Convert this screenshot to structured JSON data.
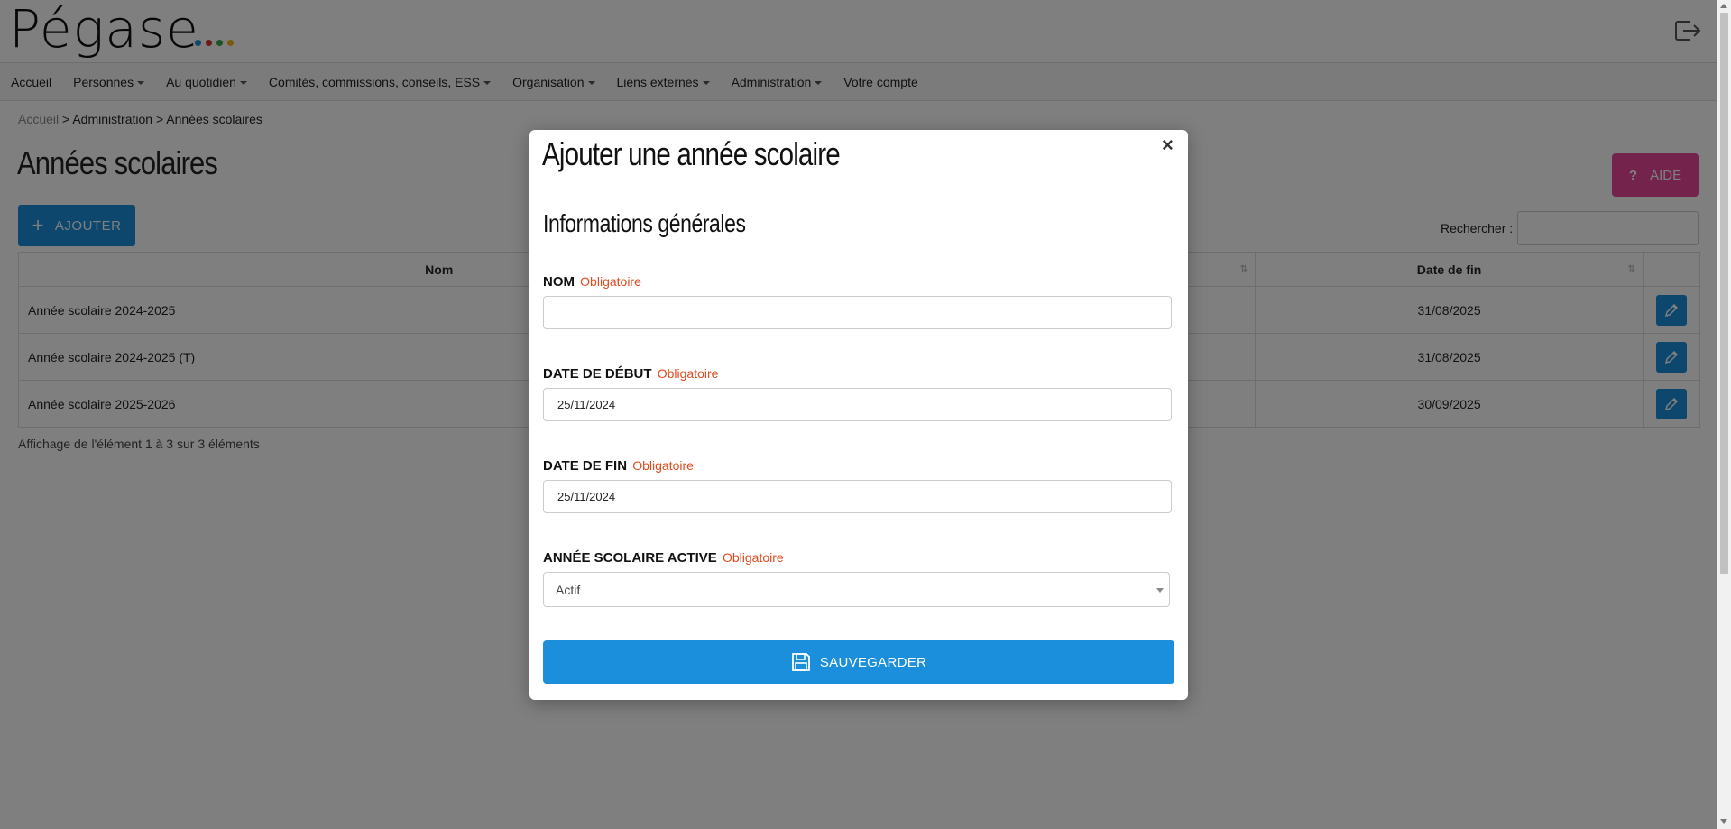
{
  "header": {
    "logo_text": "Pégase",
    "logo_dot_colors": [
      "#1b8fdc",
      "#d9352b",
      "#3aa64c",
      "#f2b21a"
    ]
  },
  "nav": {
    "items": [
      {
        "label": "Accueil",
        "dropdown": false
      },
      {
        "label": "Personnes",
        "dropdown": true
      },
      {
        "label": "Au quotidien",
        "dropdown": true
      },
      {
        "label": "Comités, commissions, conseils, ESS",
        "dropdown": true
      },
      {
        "label": "Organisation",
        "dropdown": true
      },
      {
        "label": "Liens externes",
        "dropdown": true
      },
      {
        "label": "Administration",
        "dropdown": true
      },
      {
        "label": "Votre compte",
        "dropdown": false
      }
    ]
  },
  "breadcrumb": {
    "home": "Accueil",
    "sep": ">",
    "section": "Administration",
    "current": "Années scolaires"
  },
  "page": {
    "title": "Années scolaires",
    "add_label": "AJOUTER",
    "help_label": "AIDE",
    "search_label": "Rechercher :",
    "search_value": ""
  },
  "table": {
    "columns": [
      "Nom",
      "Date de fin"
    ],
    "rows": [
      {
        "name": "Année scolaire 2024-2025",
        "end": "31/08/2025"
      },
      {
        "name": "Année scolaire 2024-2025 (T)",
        "end": "31/08/2025"
      },
      {
        "name": "Année scolaire 2025-2026",
        "end": "30/09/2025"
      }
    ],
    "info": "Affichage de l'élément 1 à 3 sur 3 éléments"
  },
  "modal": {
    "title": "Ajouter une année scolaire",
    "close": "×",
    "section": "Informations générales",
    "required_label": "Obligatoire",
    "fields": {
      "nom": {
        "label": "NOM",
        "value": ""
      },
      "debut": {
        "label": "DATE DE DÉBUT",
        "value": "25/11/2024"
      },
      "fin": {
        "label": "DATE DE FIN",
        "value": "25/11/2024"
      },
      "active": {
        "label": "ANNÉE SCOLAIRE ACTIVE",
        "value": "Actif"
      }
    },
    "save_label": "SAUVEGARDER"
  },
  "colors": {
    "primary": "#1b8fdc",
    "help": "#e8479a",
    "required": "#e04a1f"
  }
}
